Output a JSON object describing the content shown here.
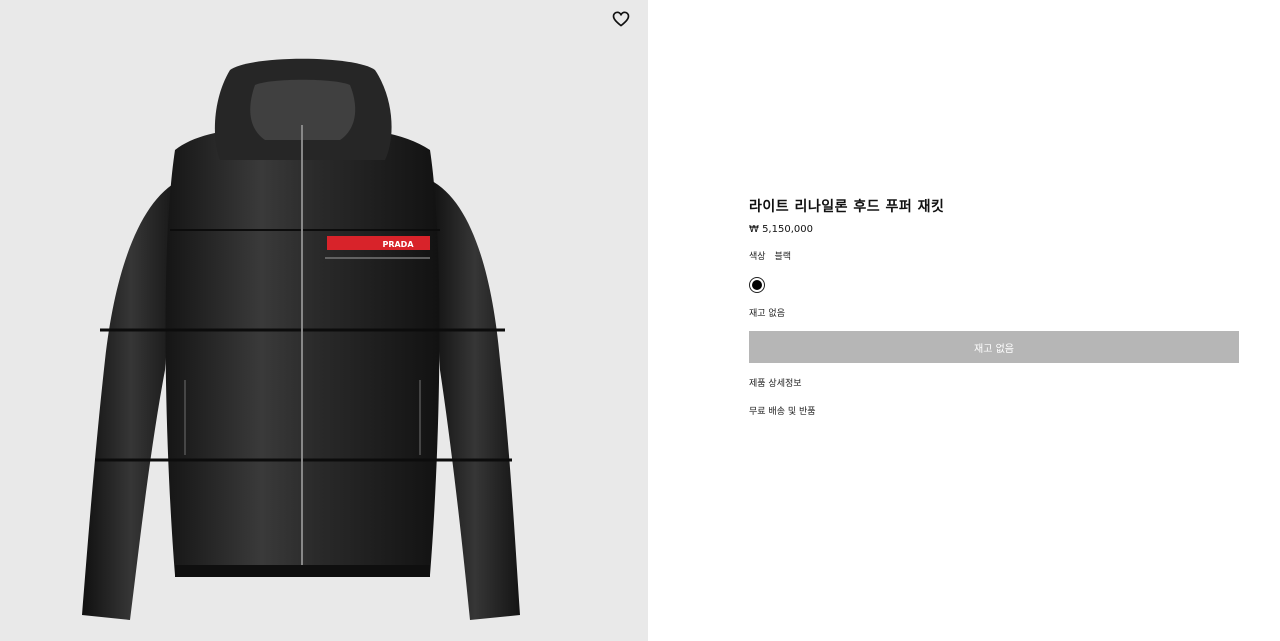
{
  "product": {
    "title": "라이트 리나일론 후드 푸퍼 재킷",
    "price": "₩ 5,150,000",
    "color_label": "색상",
    "color_value": "블랙",
    "swatch_color": "#000000",
    "stock_status": "재고 없음",
    "button_label": "재고 없음",
    "links": [
      "제품 상세정보",
      "무료 배송 및 반품"
    ],
    "brand_tag": "PRADA"
  },
  "icons": {
    "wishlist": "heart-outline-icon"
  },
  "colors": {
    "image_background": "#e9e9e9",
    "button_background": "#b6b6b6",
    "brand_tag_red": "#d8232a"
  }
}
